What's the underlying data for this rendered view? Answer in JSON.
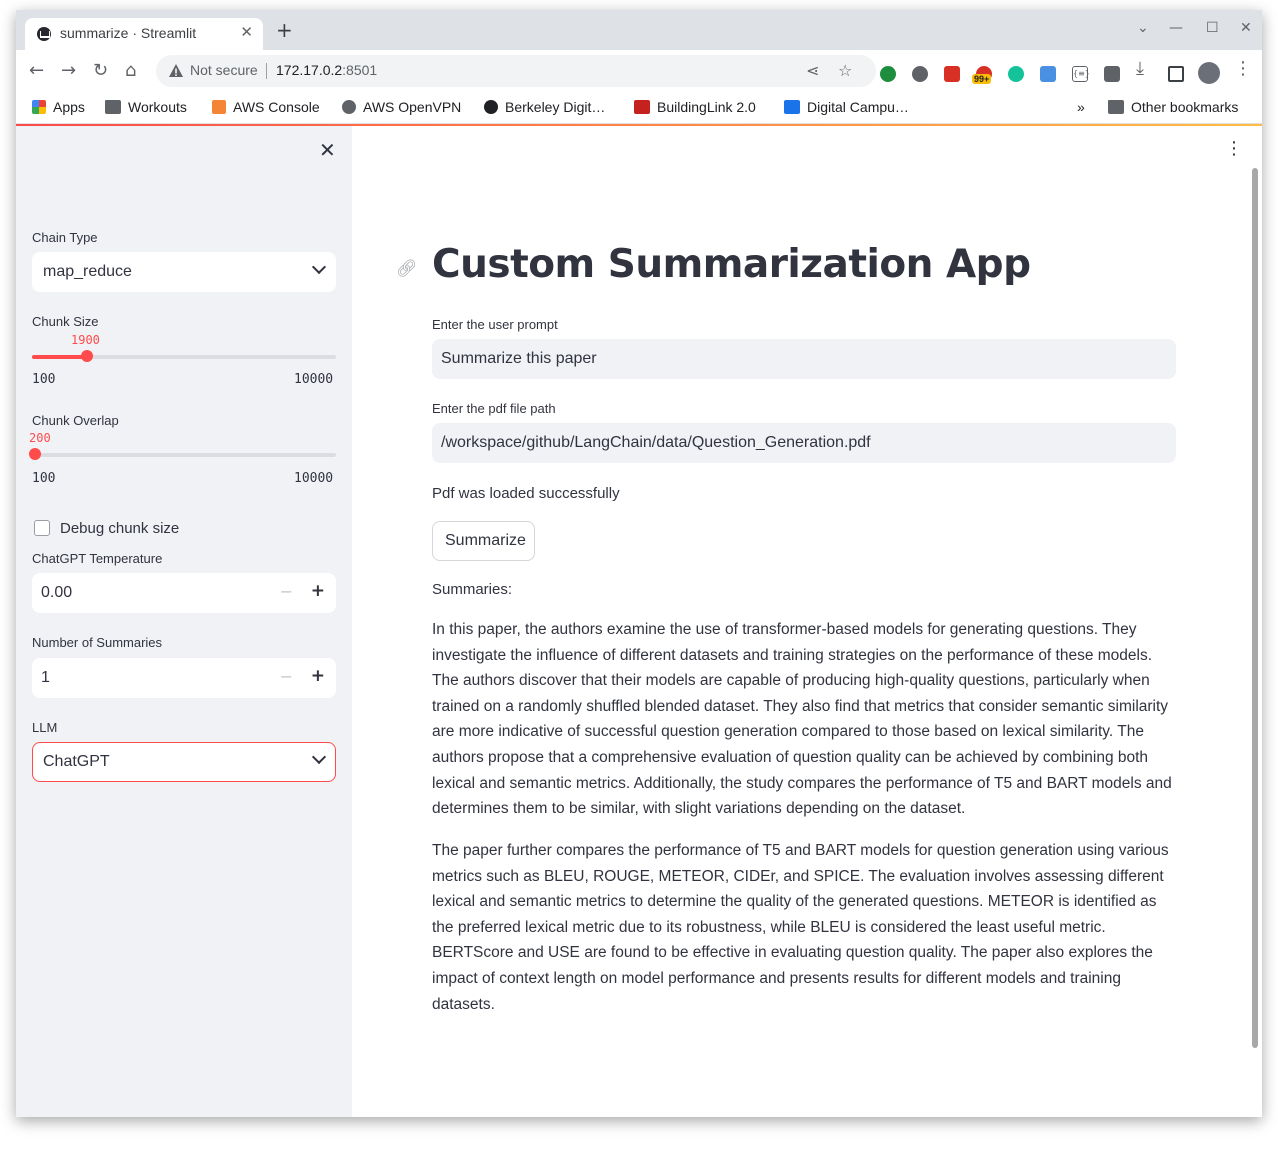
{
  "browser": {
    "tab_title": "summarize · Streamlit",
    "security_label": "Not secure",
    "url_host": "172.17.0.2",
    "url_port": ":8501",
    "extension_badge": "99+",
    "bookmarks": [
      {
        "label": "Apps"
      },
      {
        "label": "Workouts"
      },
      {
        "label": "AWS Console"
      },
      {
        "label": "AWS OpenVPN"
      },
      {
        "label": "Berkeley Digit…"
      },
      {
        "label": "BuildingLink 2.0"
      },
      {
        "label": "Digital Campu…"
      }
    ],
    "bookmarks_more": "»",
    "other_bookmarks": "Other bookmarks"
  },
  "sidebar": {
    "chain_type": {
      "label": "Chain Type",
      "value": "map_reduce"
    },
    "chunk_size": {
      "label": "Chunk Size",
      "value": "1900",
      "min": "100",
      "max": "10000",
      "fraction": 0.18
    },
    "chunk_overlap": {
      "label": "Chunk Overlap",
      "value": "200",
      "min": "100",
      "max": "10000",
      "fraction": 0.01
    },
    "debug_chunk_size": {
      "label": "Debug chunk size",
      "checked": false
    },
    "temperature": {
      "label": "ChatGPT Temperature",
      "value": "0.00"
    },
    "num_summaries": {
      "label": "Number of Summaries",
      "value": "1"
    },
    "llm": {
      "label": "LLM",
      "value": "ChatGPT"
    }
  },
  "main": {
    "title": "Custom Summarization App",
    "prompt": {
      "label": "Enter the user prompt",
      "value": "Summarize this paper"
    },
    "pdf_path": {
      "label": "Enter the pdf file path",
      "value": "/workspace/github/LangChain/data/Question_Generation.pdf"
    },
    "status": "Pdf was loaded successfully",
    "summarize_button": "Summarize",
    "summaries_heading": "Summaries:",
    "summaries": [
      "In this paper, the authors examine the use of transformer-based models for generating questions. They investigate the influence of different datasets and training strategies on the performance of these models. The authors discover that their models are capable of producing high-quality questions, particularly when trained on a randomly shuffled blended dataset. They also find that metrics that consider semantic similarity are more indicative of successful question generation compared to those based on lexical similarity. The authors propose that a comprehensive evaluation of question quality can be achieved by combining both lexical and semantic metrics. Additionally, the study compares the performance of T5 and BART models and determines them to be similar, with slight variations depending on the dataset.",
      "The paper further compares the performance of T5 and BART models for question generation using various metrics such as BLEU, ROUGE, METEOR, CIDEr, and SPICE. The evaluation involves assessing different lexical and semantic metrics to determine the quality of the generated questions. METEOR is identified as the preferred lexical metric due to its robustness, while BLEU is considered the least useful metric. BERTScore and USE are found to be effective in evaluating question quality. The paper also explores the impact of context length on model performance and presents results for different models and training datasets."
    ]
  },
  "colors": {
    "accent": "#ff4b4b",
    "sidebar_bg": "#f0f2f6",
    "text": "#31333f"
  }
}
